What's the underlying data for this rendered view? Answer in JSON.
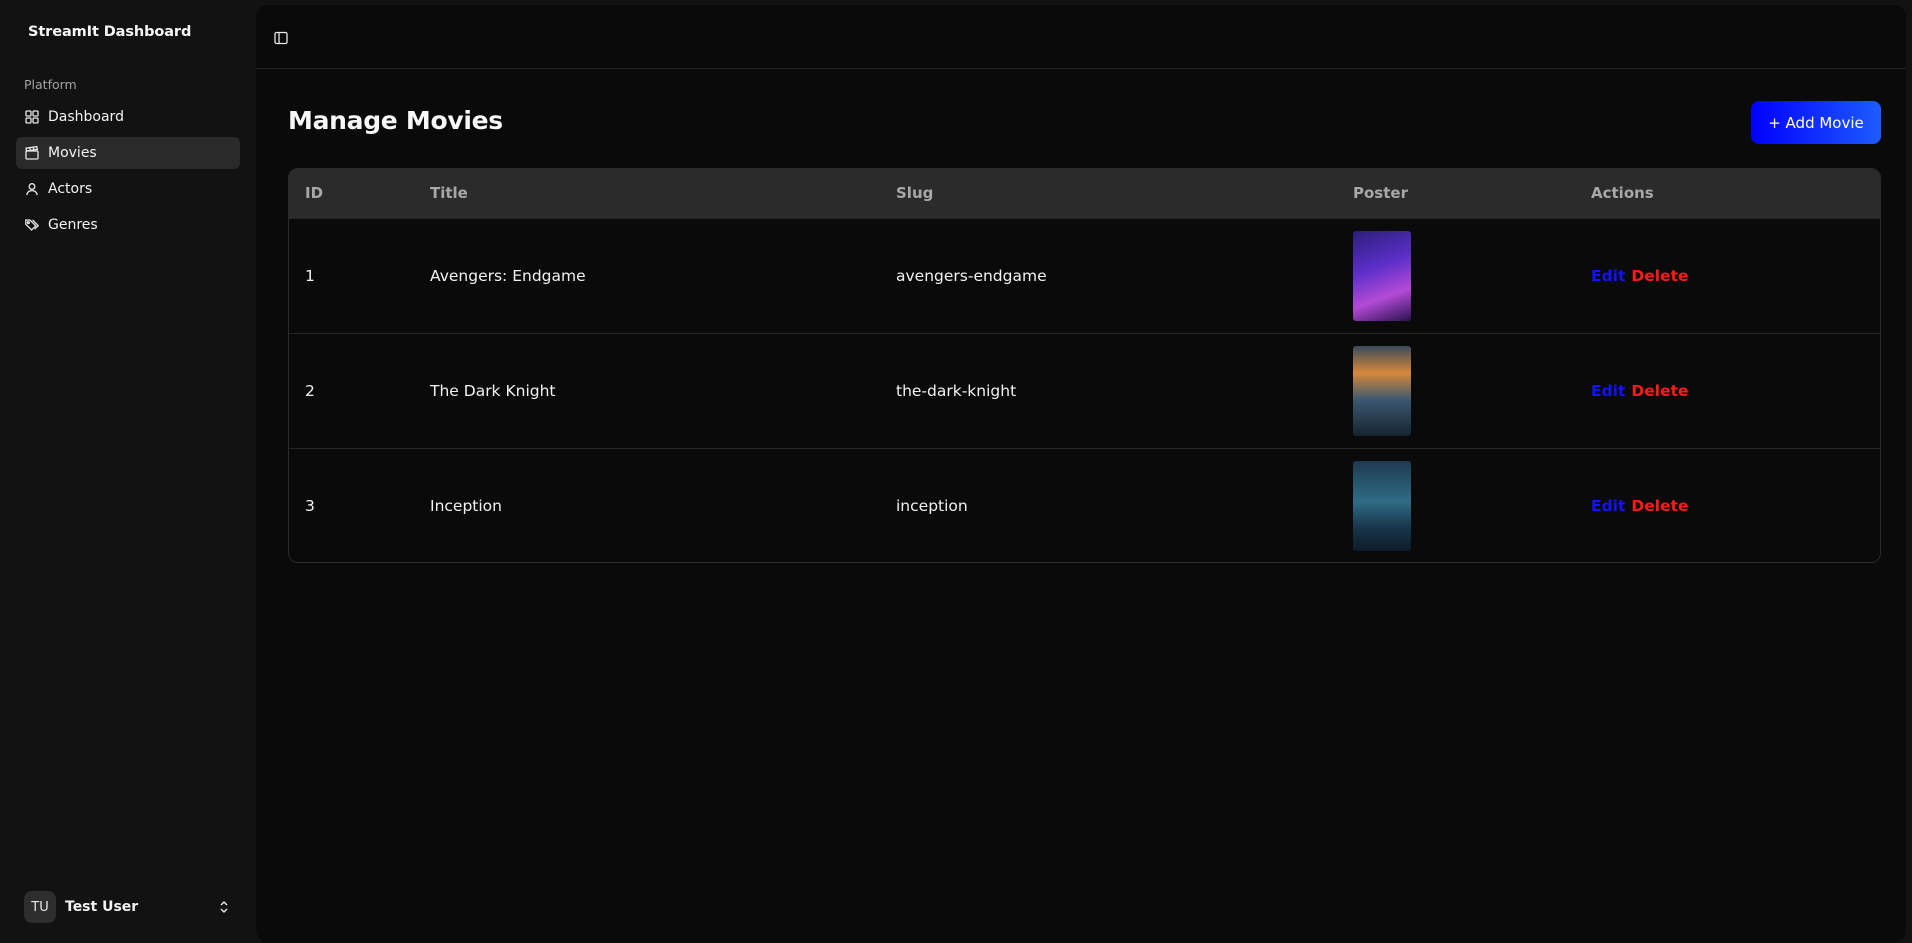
{
  "sidebar": {
    "brand": "StreamIt Dashboard",
    "group_label": "Platform",
    "items": [
      {
        "label": "Dashboard",
        "icon": "grid-icon",
        "active": false
      },
      {
        "label": "Movies",
        "icon": "clapperboard-icon",
        "active": true
      },
      {
        "label": "Actors",
        "icon": "user-icon",
        "active": false
      },
      {
        "label": "Genres",
        "icon": "tags-icon",
        "active": false
      }
    ],
    "user": {
      "initials": "TU",
      "name": "Test User",
      "icon": "chevrons-up-down-icon"
    }
  },
  "topbar": {
    "toggle_icon": "panel-left-icon"
  },
  "main": {
    "title": "Manage Movies",
    "add_label": "+ Add Movie",
    "add_color": "#0000ff",
    "table": {
      "columns": [
        "ID",
        "Title",
        "Slug",
        "Poster",
        "Actions"
      ],
      "rows": [
        {
          "id": "1",
          "title": "Avengers: Endgame",
          "slug": "avengers-endgame",
          "edit": "Edit",
          "delete": "Delete"
        },
        {
          "id": "2",
          "title": "The Dark Knight",
          "slug": "the-dark-knight",
          "edit": "Edit",
          "delete": "Delete"
        },
        {
          "id": "3",
          "title": "Inception",
          "slug": "inception",
          "edit": "Edit",
          "delete": "Delete"
        }
      ]
    },
    "colors": {
      "edit": "#1212ff",
      "delete": "#ff1a1a",
      "background": "#0a0a0a"
    }
  }
}
